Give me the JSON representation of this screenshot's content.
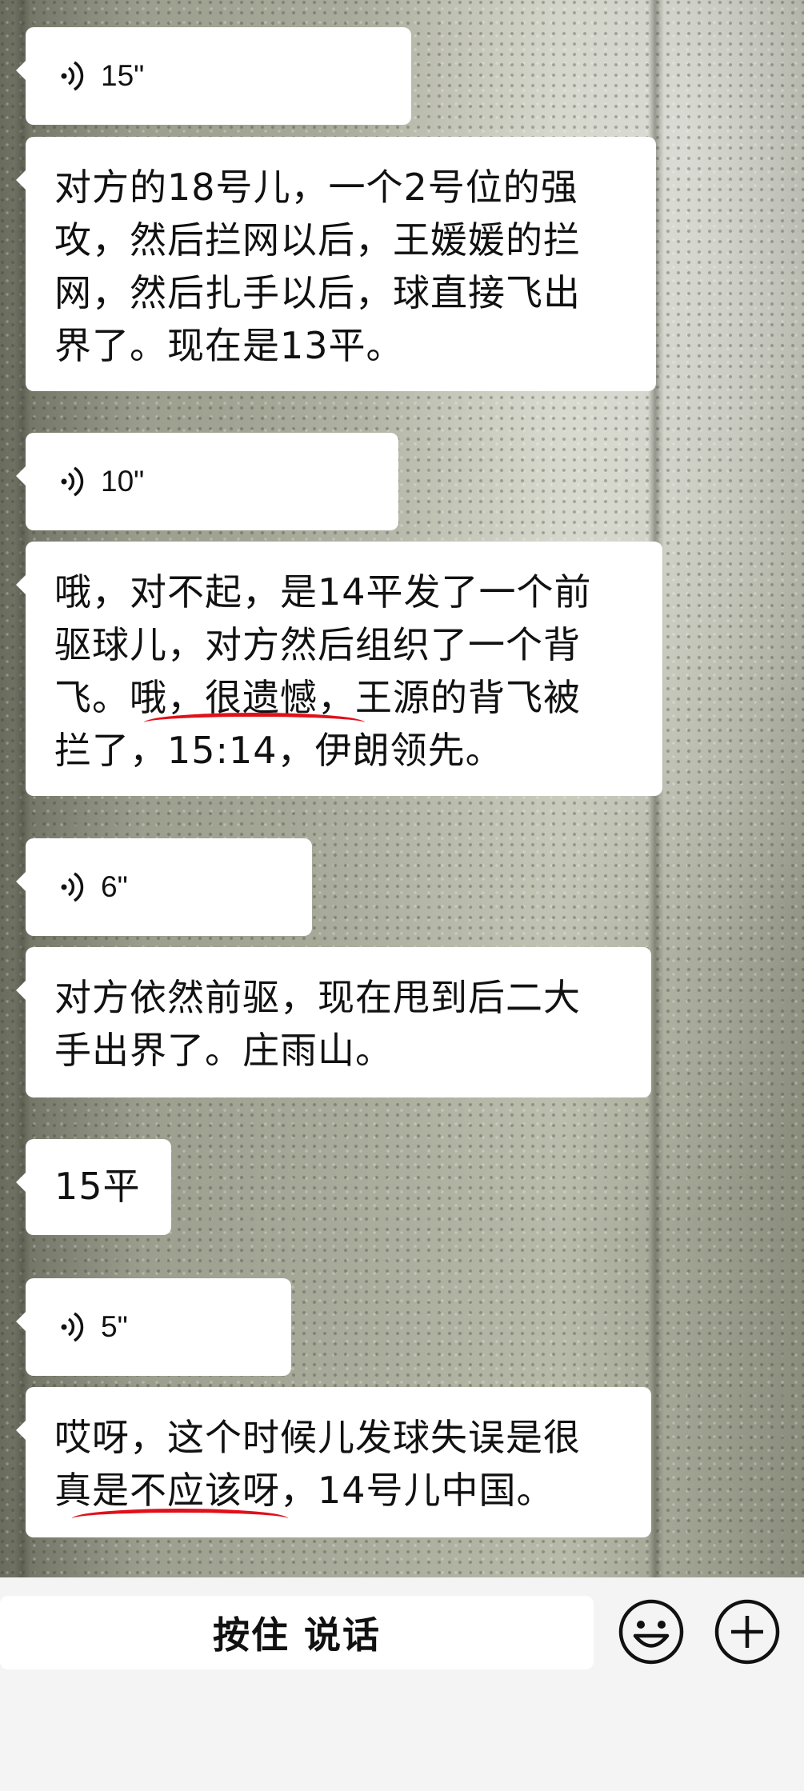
{
  "messages": [
    {
      "type": "voice",
      "duration": "15\""
    },
    {
      "type": "text",
      "lines": [
        "对方的18号儿，一个2号位的强",
        "攻，然后拦网以后，王媛媛的拦",
        "网，然后扎手以后，球直接飞出",
        "界了。现在是13平。"
      ]
    },
    {
      "type": "voice",
      "duration": "10\""
    },
    {
      "type": "text",
      "lines": [
        "哦，对不起，是14平发了一个前",
        "驱球儿，对方然后组织了一个背",
        "飞。哦，很遗憾，王源的背飞被",
        "拦了，15:14，伊朗领先。"
      ]
    },
    {
      "type": "voice",
      "duration": "6\""
    },
    {
      "type": "text",
      "lines": [
        "对方依然前驱，现在甩到后二大",
        "手出界了。庄雨山。"
      ]
    },
    {
      "type": "text",
      "lines": [
        "15平"
      ]
    },
    {
      "type": "voice",
      "duration": "5\""
    },
    {
      "type": "text",
      "lines": [
        "哎呀，这个时候儿发球失误是很",
        "真是不应该呀，14号儿中国。"
      ]
    }
  ],
  "input_bar": {
    "hold_to_talk_label": "按住 说话",
    "emoji_icon": "smiley-face-icon",
    "plus_icon": "plus-circle-icon"
  },
  "colors": {
    "bubble": "#ffffff",
    "underline_annotation": "#e0101a",
    "bar_background": "#f4f4f4"
  }
}
